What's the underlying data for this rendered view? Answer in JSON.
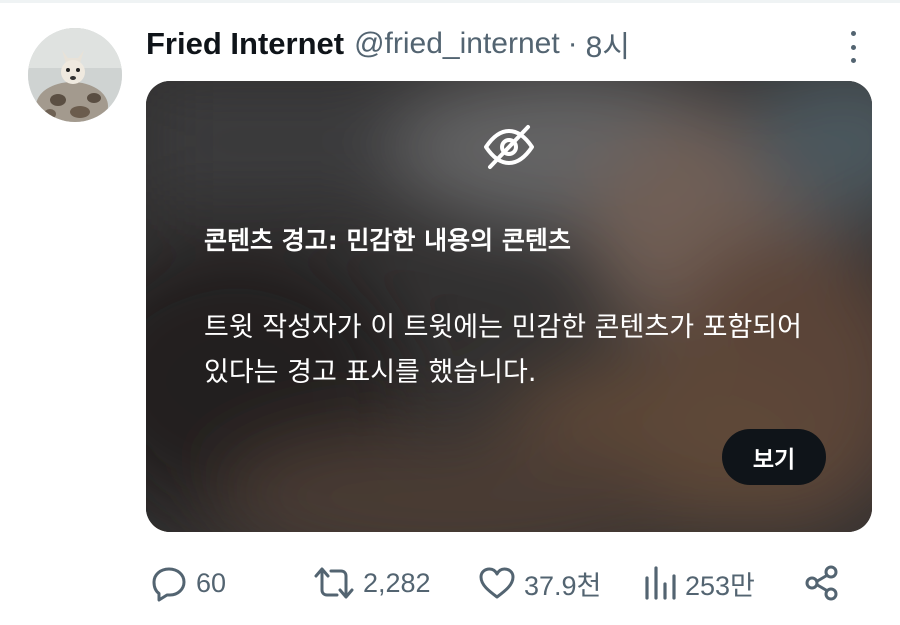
{
  "tweet": {
    "author_name": "Fried Internet",
    "handle": "@fried_internet",
    "separator": "·",
    "time": "8시"
  },
  "icons": {
    "more": "more-dots-icon",
    "hidden": "eye-slash-icon",
    "reply": "reply-icon",
    "retweet": "retweet-icon",
    "like": "heart-icon",
    "views": "views-icon",
    "share": "share-icon"
  },
  "warning": {
    "title": "콘텐츠 경고: 민감한 내용의 콘텐츠",
    "body": "트윗 작성자가 이 트윗에는 민감한 콘텐츠가 포함되어 있다는 경고 표시를 했습니다.",
    "view_button": "보기"
  },
  "actions": {
    "replies": "60",
    "retweets": "2,282",
    "likes": "37.9천",
    "views": "253만"
  },
  "colors": {
    "text_primary": "#0f1419",
    "text_secondary": "#536471",
    "button_bg": "#0f1419",
    "overlay_text": "#ffffff"
  }
}
